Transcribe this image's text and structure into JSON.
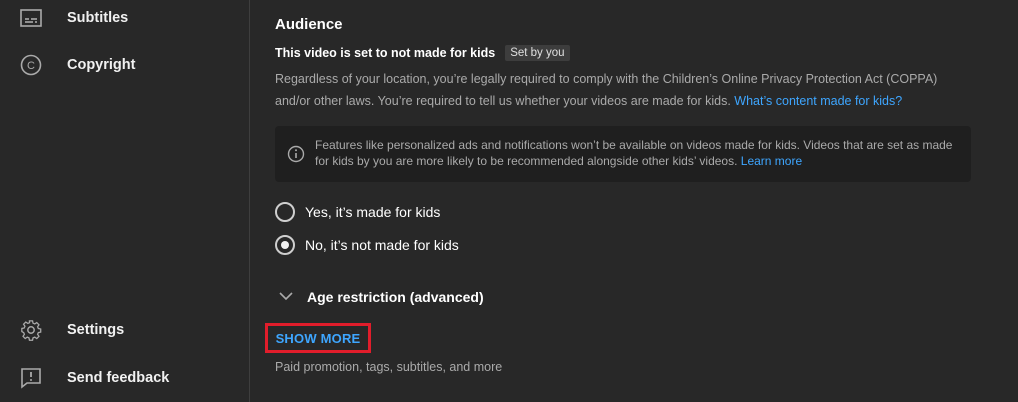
{
  "sidebar": {
    "items": [
      {
        "label": "Subtitles",
        "icon": "subtitles-icon"
      },
      {
        "label": "Copyright",
        "icon": "copyright-icon"
      },
      {
        "label": "Settings",
        "icon": "gear-icon"
      },
      {
        "label": "Send feedback",
        "icon": "feedback-icon"
      }
    ]
  },
  "audience": {
    "heading": "Audience",
    "status": "This video is set to not made for kids",
    "status_chip": "Set by you",
    "coppa_text": "Regardless of your location, you’re legally required to comply with the Children’s Online Privacy Protection Act (COPPA) and/or other laws. You’re required to tell us whether your videos are made for kids.",
    "coppa_link": "What’s content made for kids?",
    "info_text": "Features like personalized ads and notifications won’t be available on videos made for kids. Videos that are set as made for kids by you are more likely to be recommended alongside other kids’ videos.",
    "info_link": "Learn more",
    "options": [
      {
        "label": "Yes, it’s made for kids",
        "checked": false
      },
      {
        "label": "No, it’s not made for kids",
        "checked": true
      }
    ],
    "age_restriction": "Age restriction (advanced)"
  },
  "show_more": {
    "label": "SHOW MORE",
    "subtitle": "Paid promotion, tags, subtitles, and more"
  },
  "colors": {
    "background": "#282828",
    "link": "#3ea6ff",
    "highlight_border": "#e11d2b"
  }
}
